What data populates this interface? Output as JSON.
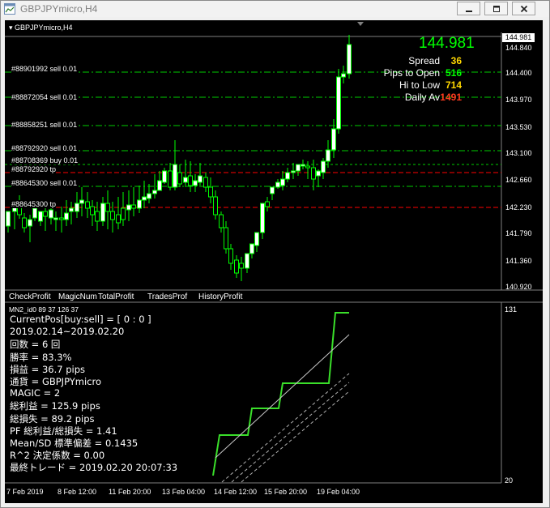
{
  "window": {
    "title": "GBPJPYmicro,H4"
  },
  "chart": {
    "symbol_label": "GBPJPYmicro,H4",
    "current_price": "144.981",
    "price_box": "144.981",
    "colors": {
      "background": "#000000",
      "bull": "#ffffff",
      "bear": "#000000",
      "candle_outline": "#00ff00",
      "sell_line": "#00cc00",
      "tp_line": "#ff0000",
      "big_price": "#00ff00"
    },
    "orders": [
      {
        "label": "#88901992 sell 0.01",
        "price": 144.4,
        "kind": "sell"
      },
      {
        "label": "#88872054 sell 0.01",
        "price": 143.97,
        "kind": "sell"
      },
      {
        "label": "#88858251 sell 0.01",
        "price": 143.53,
        "kind": "sell"
      },
      {
        "label": "#88792920 sell 0.01",
        "price": 143.04,
        "kind": "sell"
      },
      {
        "label": "#88708369 buy 0.01",
        "price": 142.86,
        "kind": "buy"
      },
      {
        "label": "#88792920 tp",
        "price": 142.76,
        "kind": "tp"
      },
      {
        "label": "#88645300 sell 0.01",
        "price": 142.53,
        "kind": "sell"
      },
      {
        "label": "#88645300 tp",
        "price": 142.2,
        "kind": "tp"
      }
    ],
    "info": [
      {
        "label": "Spread",
        "value": "36",
        "color": "#ffd700"
      },
      {
        "label": "Pips to Open",
        "value": "516",
        "color": "#00ff00"
      },
      {
        "label": "Hi to Low",
        "value": "714",
        "color": "#ffd700"
      },
      {
        "label": "Daily Av",
        "value": "1491",
        "color": "#ff3b1f"
      }
    ],
    "price_axis": [
      "144.840",
      "144.400",
      "143.970",
      "143.530",
      "143.100",
      "142.660",
      "142.230",
      "141.790",
      "141.360",
      "140.920"
    ],
    "price_min": 140.92,
    "price_max": 144.981
  },
  "subwindow": {
    "tabs": [
      "CheckProfit",
      "MagicNum",
      "TotalProfit",
      "TradesProf",
      "HistoryProfit"
    ],
    "header": "MN2_id0 89 37 126 37",
    "stats": [
      "CurrentPos[buy:sell] = [ 0 : 0 ]",
      "2019.02.14~2019.02.20",
      "回数 = 6 回",
      "勝率 = 83.3%",
      "損益 = 36.7 pips",
      "通貨 = GBPJPYmicro",
      "MAGIC  = 2",
      "総利益 = 125.9 pips",
      "総損失 = 89.2 pips",
      "PF 総利益/総損失 = 1.41",
      "Mean/SD  標準偏差 = 0.1435",
      "R^2 決定係数 = 0.00",
      "最終トレード  = 2019.02.20 20:07:33"
    ],
    "axis_top": "131",
    "axis_bottom": "20"
  },
  "time_axis": [
    "7 Feb 2019",
    "8 Feb 12:00",
    "11 Feb 20:00",
    "13 Feb 04:00",
    "14 Feb 12:00",
    "15 Feb 20:00",
    "19 Feb 04:00"
  ]
}
